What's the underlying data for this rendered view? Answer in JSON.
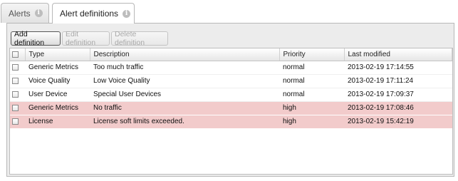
{
  "tabs": [
    {
      "label": "Alerts",
      "active": false
    },
    {
      "label": "Alert definitions",
      "active": true
    }
  ],
  "toolbar": {
    "add_label": "Add definition",
    "edit_label": "Edit definition",
    "delete_label": "Delete definition"
  },
  "table": {
    "columns": [
      "Type",
      "Description",
      "Priority",
      "Last modified"
    ],
    "rows": [
      {
        "type": "Generic Metrics",
        "description": "Too much traffic",
        "priority": "normal",
        "modified": "2013-02-19 17:14:55",
        "highlight": false
      },
      {
        "type": "Voice Quality",
        "description": "Low Voice Quality",
        "priority": "normal",
        "modified": "2013-02-19 17:11:24",
        "highlight": false
      },
      {
        "type": "User Device",
        "description": "Special User Devices",
        "priority": "normal",
        "modified": "2013-02-19 17:09:37",
        "highlight": false
      },
      {
        "type": "Generic Metrics",
        "description": "No traffic",
        "priority": "high",
        "modified": "2013-02-19 17:08:46",
        "highlight": true
      },
      {
        "type": "License",
        "description": "License soft limits exceeded.",
        "priority": "high",
        "modified": "2013-02-19 15:42:19",
        "highlight": true
      }
    ]
  },
  "colors": {
    "highlight_row": "#f2cbcb",
    "panel_bg": "#ececec"
  },
  "icons": {
    "tab_info": "info-icon"
  }
}
